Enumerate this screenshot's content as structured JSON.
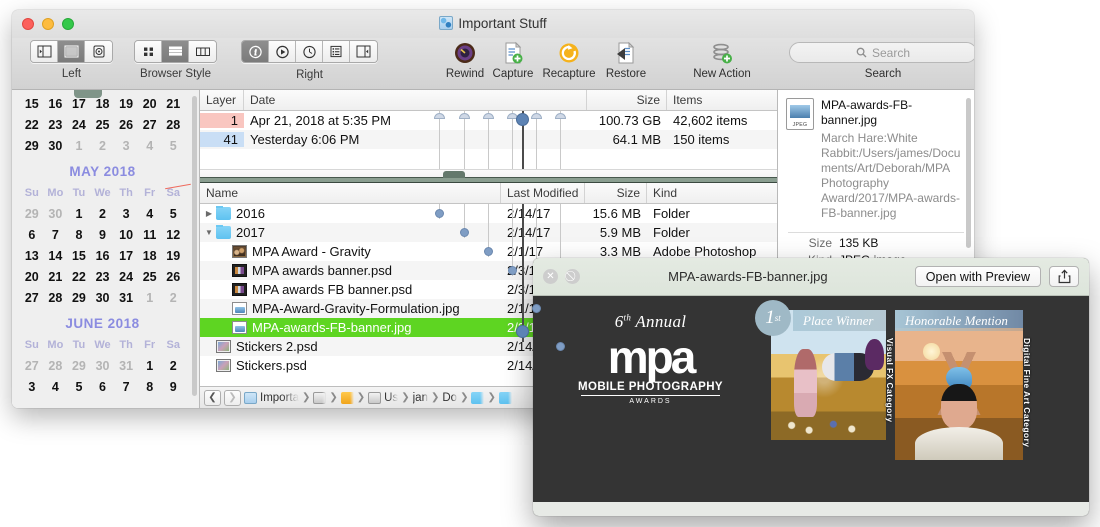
{
  "window": {
    "title": "Important Stuff",
    "title_icon": "app-icon",
    "traffic_lights": [
      "close-button",
      "minimize-button",
      "zoom-button"
    ]
  },
  "toolbar": {
    "left_group": {
      "label": "Left",
      "buttons": [
        {
          "name": "sidebar-toggle-icon",
          "active": false
        },
        {
          "name": "grid-view-icon",
          "active": true
        },
        {
          "name": "timeline-icon",
          "active": false
        }
      ]
    },
    "browser_style_group": {
      "label": "Browser Style",
      "buttons": [
        {
          "name": "icon-view-icon",
          "active": false
        },
        {
          "name": "list-view-icon",
          "active": true
        },
        {
          "name": "column-view-icon",
          "active": false
        }
      ]
    },
    "right_group": {
      "label": "Right",
      "buttons": [
        {
          "name": "info-icon",
          "active": true
        },
        {
          "name": "play-icon",
          "active": false
        },
        {
          "name": "clock-icon",
          "active": false
        },
        {
          "name": "list-icon",
          "active": false
        },
        {
          "name": "inspector-toggle-icon",
          "active": false
        }
      ]
    },
    "actions": [
      {
        "label": "Rewind",
        "icon": "rewind-icon"
      },
      {
        "label": "Capture",
        "icon": "capture-icon"
      },
      {
        "label": "Recapture",
        "icon": "recapture-icon"
      },
      {
        "label": "Restore",
        "icon": "restore-icon"
      },
      {
        "label": "New Action",
        "icon": "new-action-icon"
      }
    ],
    "search": {
      "placeholder": "Search",
      "value": "",
      "caption": "Search",
      "icon": "search-icon"
    }
  },
  "calendar": {
    "top_partial_rows": [
      [
        "15",
        "16",
        "17",
        "18",
        "19",
        "20",
        "21"
      ],
      [
        "22",
        "23",
        "24",
        "25",
        "26",
        "27",
        "28"
      ],
      [
        "29",
        "30",
        "1",
        "2",
        "3",
        "4",
        "5"
      ]
    ],
    "top_dim_flags": [
      [
        false,
        false,
        false,
        false,
        false,
        false,
        false
      ],
      [
        false,
        false,
        false,
        false,
        false,
        false,
        false
      ],
      [
        false,
        false,
        true,
        true,
        true,
        true,
        true
      ]
    ],
    "today": "21",
    "months": [
      {
        "title": "MAY 2018",
        "dow": [
          "Su",
          "Mo",
          "Tu",
          "We",
          "Th",
          "Fr",
          "Sa"
        ],
        "weeks": [
          [
            "29",
            "30",
            "1",
            "2",
            "3",
            "4",
            "5"
          ],
          [
            "6",
            "7",
            "8",
            "9",
            "10",
            "11",
            "12"
          ],
          [
            "13",
            "14",
            "15",
            "16",
            "17",
            "18",
            "19"
          ],
          [
            "20",
            "21",
            "22",
            "23",
            "24",
            "25",
            "26"
          ],
          [
            "27",
            "28",
            "29",
            "30",
            "31",
            "1",
            "2"
          ]
        ],
        "dim": [
          [
            true,
            true,
            false,
            false,
            false,
            false,
            false
          ],
          [
            false,
            false,
            false,
            false,
            false,
            false,
            false
          ],
          [
            false,
            false,
            false,
            false,
            false,
            false,
            false
          ],
          [
            false,
            false,
            false,
            false,
            false,
            false,
            false
          ],
          [
            false,
            false,
            false,
            false,
            false,
            true,
            true
          ]
        ]
      },
      {
        "title": "JUNE 2018",
        "dow": [
          "Su",
          "Mo",
          "Tu",
          "We",
          "Th",
          "Fr",
          "Sa"
        ],
        "weeks": [
          [
            "27",
            "28",
            "29",
            "30",
            "31",
            "1",
            "2"
          ],
          [
            "3",
            "4",
            "5",
            "6",
            "7",
            "8",
            "9"
          ]
        ],
        "dim": [
          [
            true,
            true,
            true,
            true,
            true,
            false,
            false
          ],
          [
            false,
            false,
            false,
            false,
            false,
            false,
            false
          ]
        ]
      }
    ]
  },
  "layer_table": {
    "columns": [
      "Layer",
      "Date",
      "Size",
      "Items"
    ],
    "rows": [
      {
        "layer": "1",
        "date": "Apr 21, 2018 at 5:35 PM",
        "size": "100.73 GB",
        "items": "42,602 items",
        "chip": "pink"
      },
      {
        "layer": "41",
        "date": "Yesterday 6:06 PM",
        "size": "64.1 MB",
        "items": "150 items",
        "chip": "blue"
      }
    ]
  },
  "file_table": {
    "columns": [
      "Name",
      "Last Modified",
      "Size",
      "Kind"
    ],
    "rows": [
      {
        "name": "2016",
        "modified": "2/14/17",
        "size": "15.6 MB",
        "kind": "Folder",
        "icon": "folder-icon",
        "indent": 0,
        "disclosure": "▶",
        "selected": false
      },
      {
        "name": "2017",
        "modified": "2/14/17",
        "size": "5.9 MB",
        "kind": "Folder",
        "icon": "folder-icon",
        "indent": 0,
        "disclosure": "▼",
        "selected": false
      },
      {
        "name": "MPA Award - Gravity",
        "modified": "2/1/17",
        "size": "3.3 MB",
        "kind": "Adobe Photoshop",
        "icon": "thumbnail-icon",
        "indent": 1,
        "disclosure": "",
        "selected": false
      },
      {
        "name": "MPA awards banner.psd",
        "modified": "2/3/17",
        "size": "",
        "kind": "",
        "icon": "psd-icon",
        "indent": 1,
        "disclosure": "",
        "selected": false
      },
      {
        "name": "MPA awards FB banner.psd",
        "modified": "2/3/17",
        "size": "",
        "kind": "",
        "icon": "psd-icon",
        "indent": 1,
        "disclosure": "",
        "selected": false
      },
      {
        "name": "MPA-Award-Gravity-Formulation.jpg",
        "modified": "2/1/17",
        "size": "",
        "kind": "",
        "icon": "jpeg-icon",
        "indent": 1,
        "disclosure": "",
        "selected": false
      },
      {
        "name": "MPA-awards-FB-banner.jpg",
        "modified": "2/3/17",
        "size": "",
        "kind": "",
        "icon": "jpeg-icon",
        "indent": 1,
        "disclosure": "",
        "selected": true
      },
      {
        "name": "Stickers 2.psd",
        "modified": "2/14/16",
        "size": "",
        "kind": "",
        "icon": "sticker-icon",
        "indent": 0,
        "disclosure": "",
        "selected": false
      },
      {
        "name": "Stickers.psd",
        "modified": "2/14/16",
        "size": "",
        "kind": "",
        "icon": "sticker-icon",
        "indent": 0,
        "disclosure": "",
        "selected": false
      }
    ],
    "selection_color": "#5ed522"
  },
  "pathbar": {
    "back_icon": "chevron-left-icon",
    "forward_icon": "chevron-right-icon",
    "crumbs": [
      {
        "label": "Importa",
        "icon": "app-icon"
      },
      {
        "label": "",
        "icon": "computer-icon"
      },
      {
        "label": "",
        "icon": "disk-icon"
      },
      {
        "label": "Us",
        "icon": "users-folder-icon"
      },
      {
        "label": "jan",
        "icon": ""
      },
      {
        "label": "Do",
        "icon": ""
      },
      {
        "label": "",
        "icon": "folder-icon"
      },
      {
        "label": "",
        "icon": "folder-icon"
      }
    ]
  },
  "inspector": {
    "icon": "jpeg-file-icon",
    "icon_label": "JPEG",
    "filename": "MPA-awards-FB-banner.jpg",
    "path": "March Hare:White Rabbit:/Users/james/Documents/Art/Deborah/MPA Photography Award/2017/MPA-awards-FB-banner.jpg",
    "fields": [
      {
        "key": "Size",
        "value": "135 KB"
      },
      {
        "key": "Kind",
        "value": "JPEG image"
      }
    ]
  },
  "preview_window": {
    "title": "MPA-awards-FB-banner.jpg",
    "close_icon": "close-icon",
    "block_icon": "no-entry-icon",
    "open_button": "Open with Preview",
    "share_icon": "share-icon",
    "image": {
      "background": "#343434",
      "logo": {
        "annual": "Annual",
        "annual_ordinal": "6",
        "annual_suffix": "th",
        "wordmark": "mpa",
        "line1": "MOBILE PHOTOGRAPHY",
        "line2": "AWARDS"
      },
      "awards": [
        {
          "badge_number": "1",
          "badge_suffix": "st",
          "ribbon": "Place Winner",
          "category": "Visual FX Category"
        },
        {
          "badge_number": "",
          "badge_suffix": "",
          "ribbon": "Honorable Mention",
          "category": "Digital Fine Art Category"
        }
      ]
    }
  }
}
